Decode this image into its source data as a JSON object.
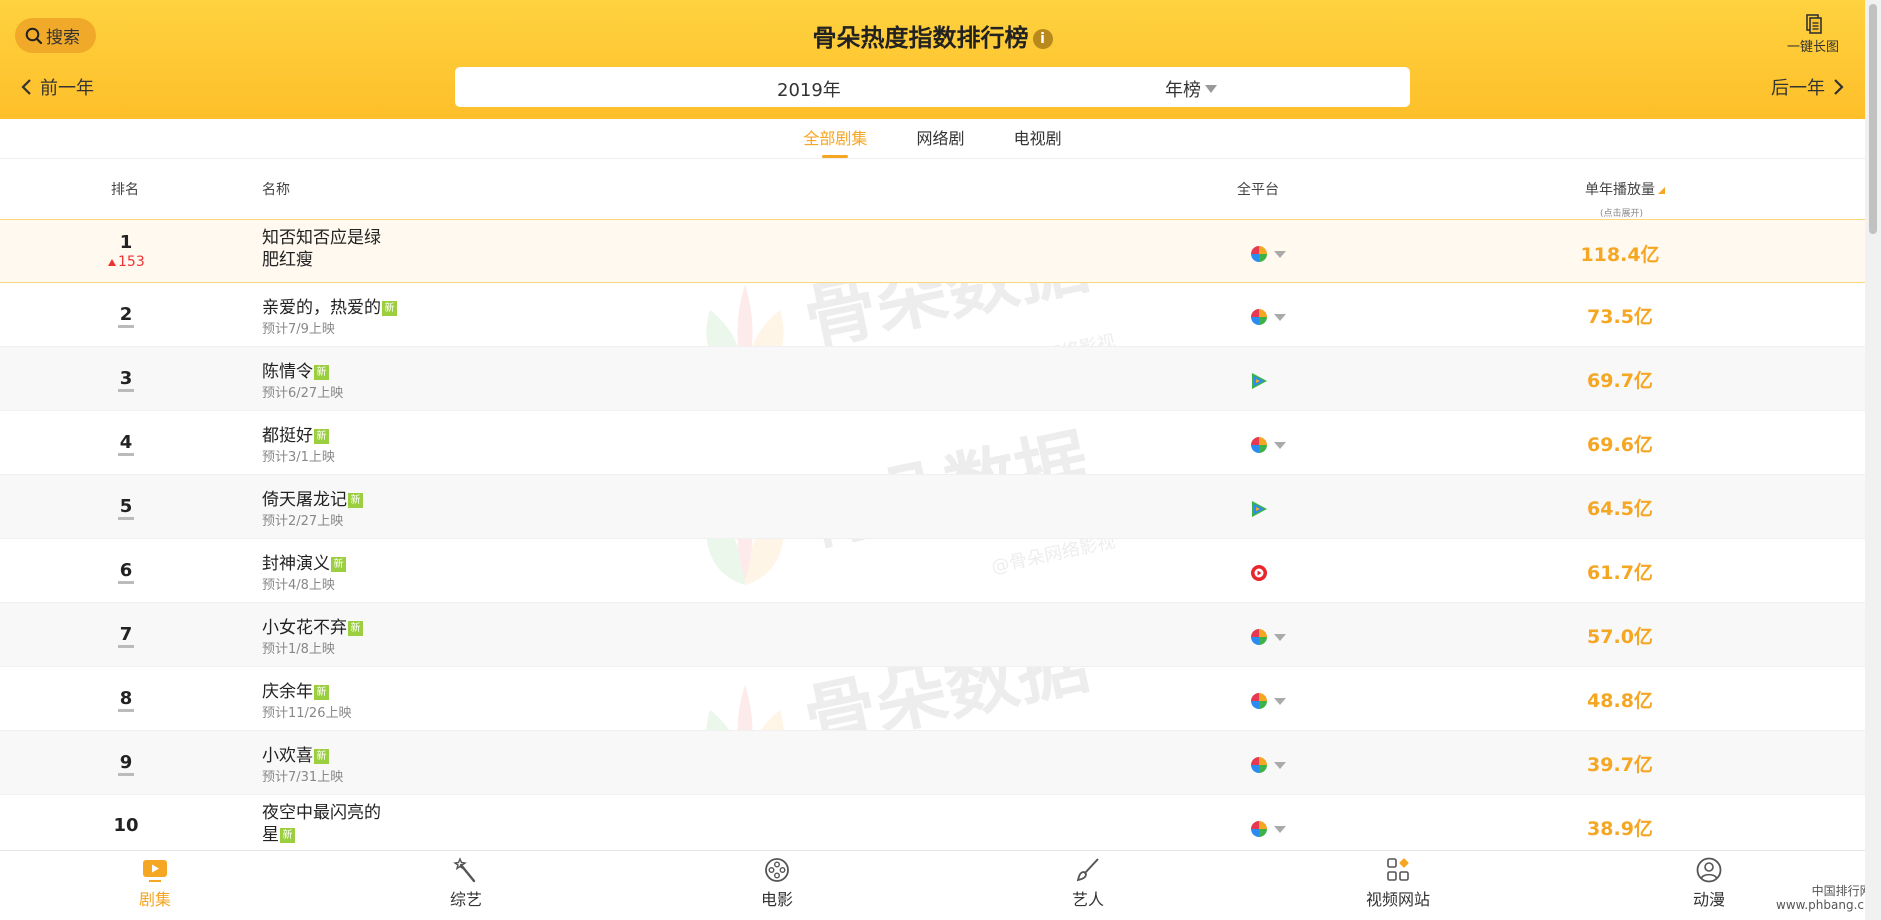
{
  "header": {
    "search_label": "搜索",
    "title": "骨朵热度指数排行榜",
    "info_icon": "i",
    "long_image_label": "一键长图",
    "prev_label": "前一年",
    "next_label": "后一年",
    "year_value": "2019年",
    "type_value": "年榜"
  },
  "tabs": [
    {
      "label": "全部剧集",
      "active": true
    },
    {
      "label": "网络剧",
      "active": false
    },
    {
      "label": "电视剧",
      "active": false
    }
  ],
  "table": {
    "headers": {
      "rank": "排名",
      "name": "名称",
      "platform": "全平台",
      "plays": "单年播放量",
      "plays_hint": "(点击展开)"
    },
    "rows": [
      {
        "rank": "1",
        "change": "153",
        "name_line1": "知否知否应是绿",
        "name_line2": "肥红瘦",
        "platform": "multi",
        "plays": "118.4亿"
      },
      {
        "rank": "2",
        "name": "亲爱的，热爱的",
        "new": "新",
        "sub": "预计7/9上映",
        "platform": "multi",
        "plays": "73.5亿"
      },
      {
        "rank": "3",
        "name": "陈情令",
        "new": "新",
        "sub": "预计6/27上映",
        "platform": "tencent",
        "plays": "69.7亿"
      },
      {
        "rank": "4",
        "name": "都挺好",
        "new": "新",
        "sub": "预计3/1上映",
        "platform": "multi",
        "plays": "69.6亿"
      },
      {
        "rank": "5",
        "name": "倚天屠龙记",
        "new": "新",
        "sub": "预计2/27上映",
        "platform": "tencent",
        "plays": "64.5亿"
      },
      {
        "rank": "6",
        "name": "封神演义",
        "new": "新",
        "sub": "预计4/8上映",
        "platform": "youku",
        "plays": "61.7亿"
      },
      {
        "rank": "7",
        "name": "小女花不弃",
        "new": "新",
        "sub": "预计1/8上映",
        "platform": "multi",
        "plays": "57.0亿"
      },
      {
        "rank": "8",
        "name": "庆余年",
        "new": "新",
        "sub": "预计11/26上映",
        "platform": "multi",
        "plays": "48.8亿"
      },
      {
        "rank": "9",
        "name": "小欢喜",
        "new": "新",
        "sub": "预计7/31上映",
        "platform": "multi",
        "plays": "39.7亿"
      },
      {
        "rank": "10",
        "name_line1": "夜空中最闪亮的",
        "name_line2": "星",
        "new": "新",
        "platform": "multi",
        "plays": "38.9亿"
      }
    ]
  },
  "watermark": {
    "text": "骨朵数据",
    "sub": "@骨朵网络影视"
  },
  "bottom_nav": [
    {
      "label": "剧集",
      "icon": "tv-play-icon",
      "active": true
    },
    {
      "label": "综艺",
      "icon": "magic-wand-icon",
      "active": false
    },
    {
      "label": "电影",
      "icon": "film-reel-icon",
      "active": false
    },
    {
      "label": "艺人",
      "icon": "brush-icon",
      "active": false
    },
    {
      "label": "视频网站",
      "icon": "apps-grid-icon",
      "active": false
    },
    {
      "label": "动漫",
      "icon": "user-circle-icon",
      "active": false
    }
  ],
  "corner_watermark": {
    "line1": "中国排行网",
    "line2": "www.phbang.cn"
  },
  "colors": {
    "accent": "#f5a623",
    "header": "#fdc42f",
    "new_badge": "#9ccf3f",
    "rise": "#e33333"
  }
}
